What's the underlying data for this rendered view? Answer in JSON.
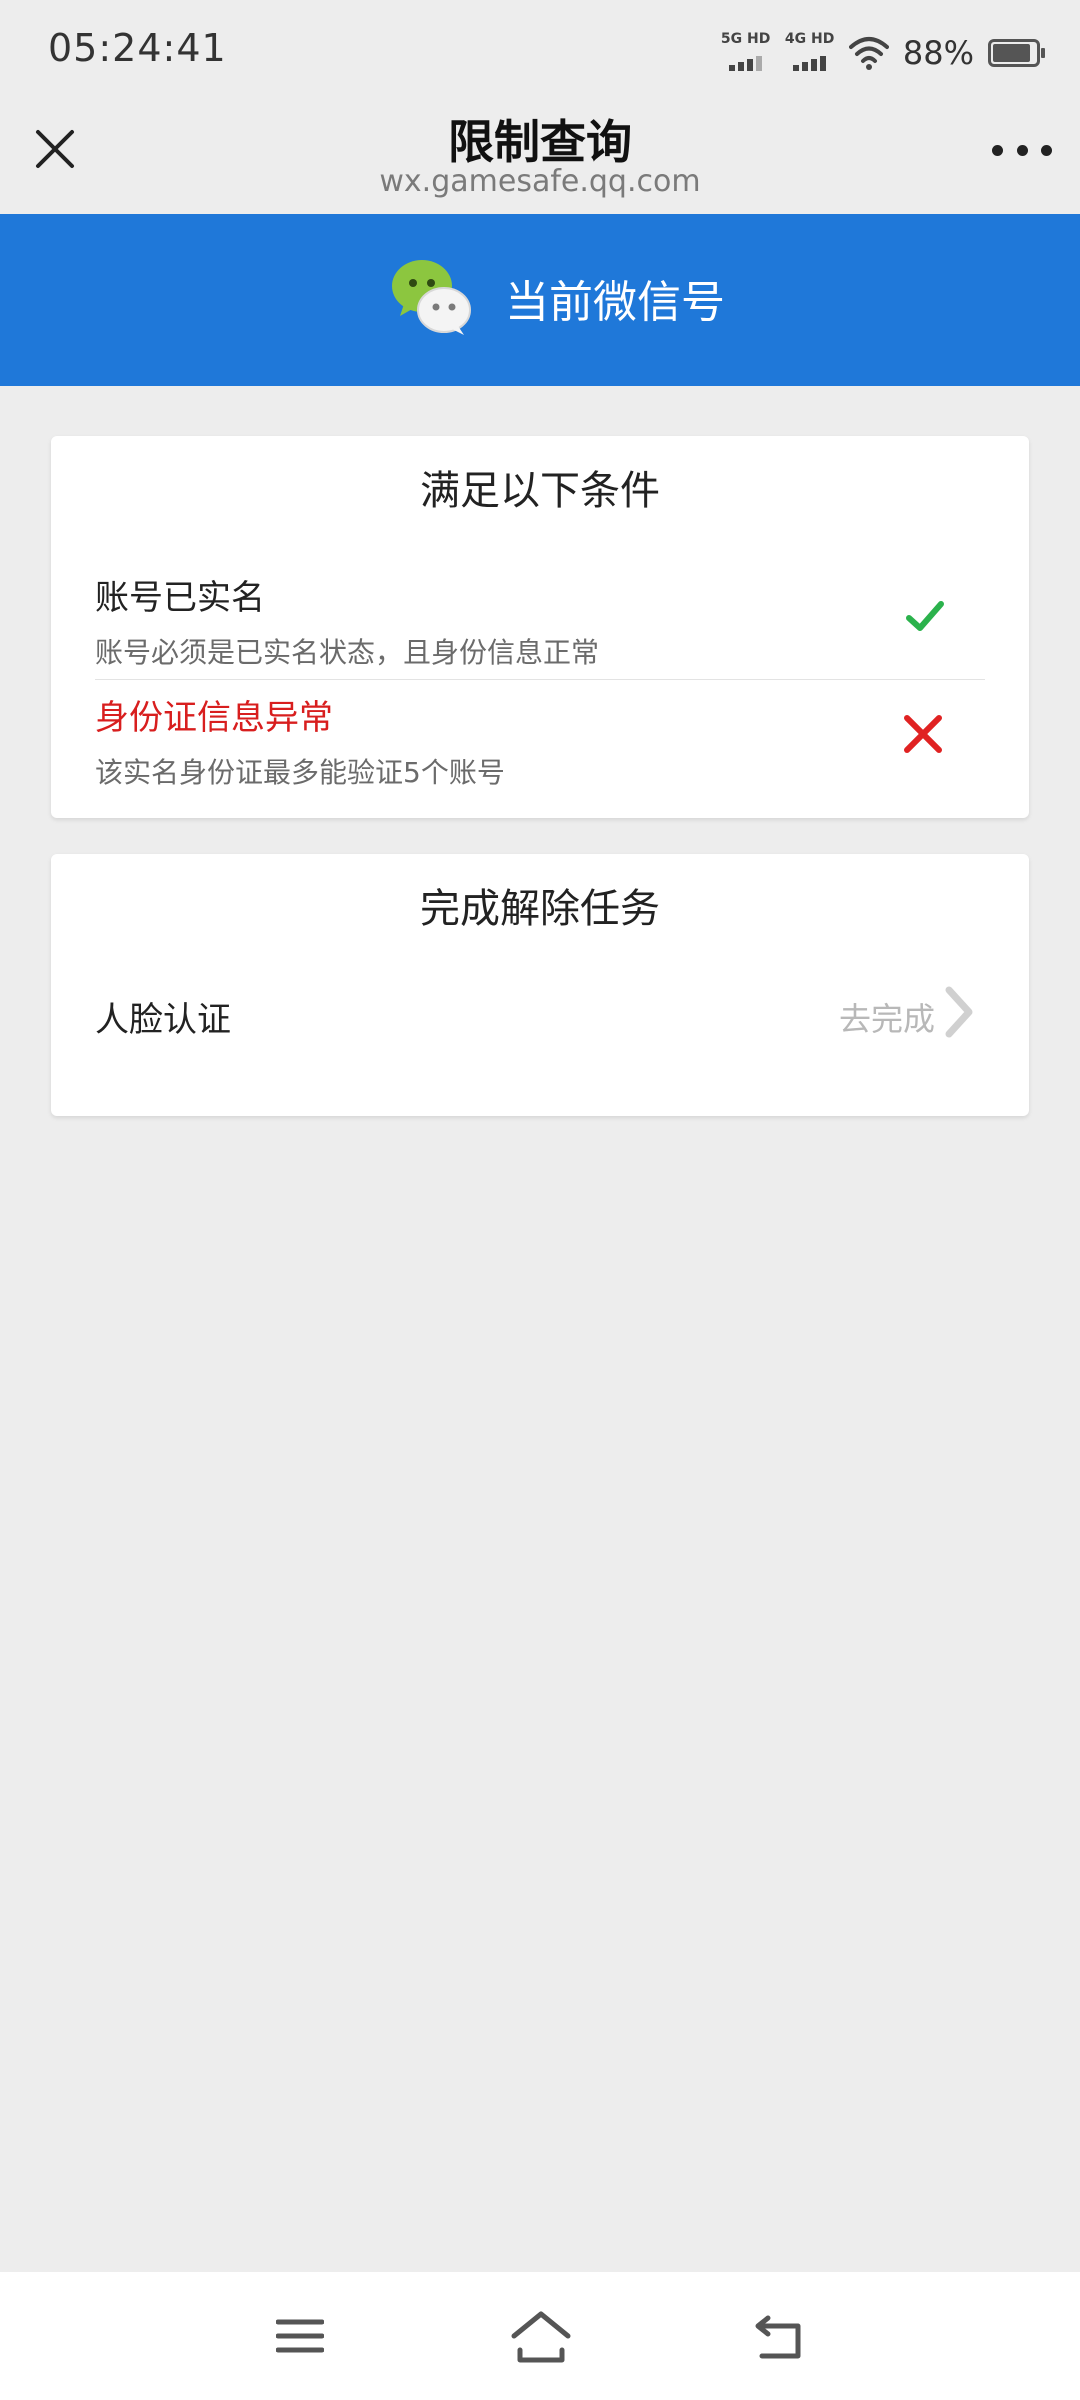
{
  "status_bar": {
    "time": "05:24:41",
    "signal1_label": "5G HD",
    "signal2_label": "4G HD",
    "battery_text": "88%",
    "battery_level": 0.88
  },
  "nav": {
    "title": "限制查询",
    "subtitle": "wx.gamesafe.qq.com",
    "close_icon": "close-icon",
    "more_icon": "more-icon"
  },
  "banner": {
    "title": "当前微信号",
    "icon": "wechat-logo",
    "color": "#1f78d9"
  },
  "conditions": {
    "title": "满足以下条件",
    "items": [
      {
        "title": "账号已实名",
        "desc": "账号必须是已实名状态，且身份信息正常",
        "status": "check",
        "status_color": "#2bb24c"
      },
      {
        "title": "身份证信息异常",
        "desc": "该实名身份证最多能验证5个账号",
        "status": "cross",
        "status_color": "#e02222",
        "title_color": "#d81e1e"
      }
    ]
  },
  "tasks": {
    "title": "完成解除任务",
    "items": [
      {
        "label": "人脸认证",
        "action": "去完成"
      }
    ]
  },
  "bottom_nav": {
    "icons": [
      "menu-icon",
      "home-icon",
      "back-icon"
    ]
  }
}
